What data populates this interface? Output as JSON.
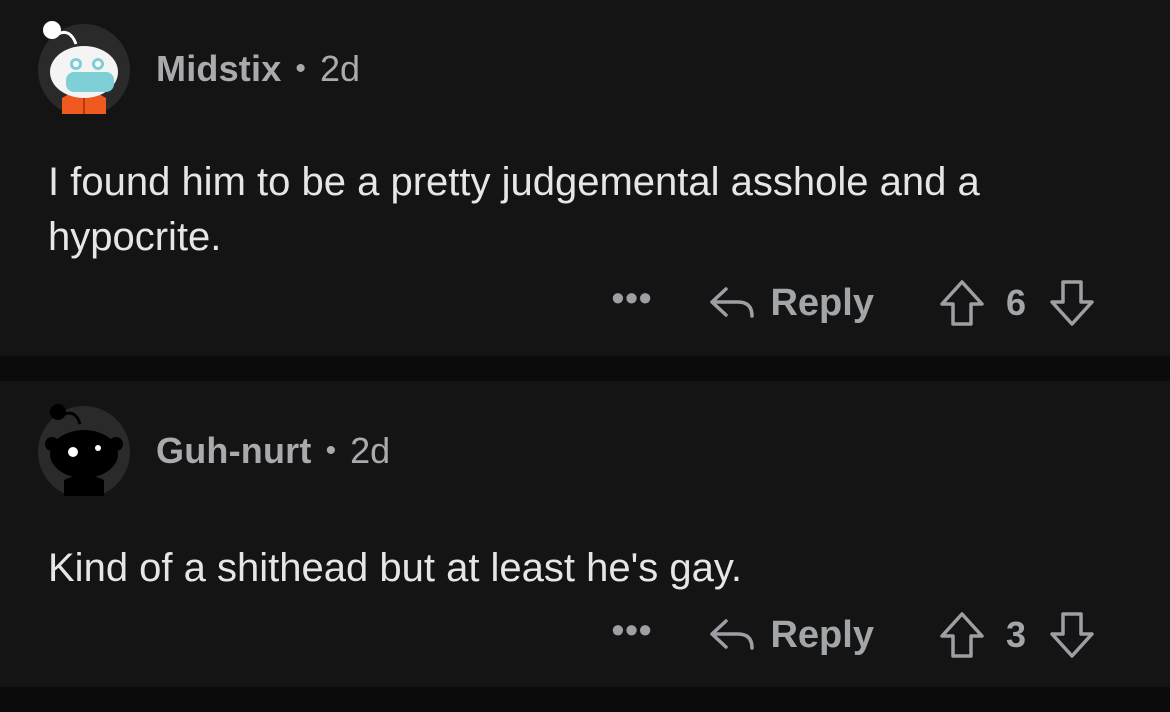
{
  "comments": [
    {
      "username": "Midstix",
      "separator": "•",
      "age": "2d",
      "body": "I found him to be a pretty judgemental asshole and a hypocrite.",
      "more_label": "•••",
      "reply_label": "Reply",
      "score": "6",
      "avatar": "snoo-avatar-mask-orange-jacket"
    },
    {
      "username": "Guh-nurt",
      "separator": "•",
      "age": "2d",
      "body": "Kind of a shithead but at least he's gay.",
      "more_label": "•••",
      "reply_label": "Reply",
      "score": "3",
      "avatar": "snoo-avatar-black"
    }
  ],
  "colors": {
    "background": "#0b0b0b",
    "card": "#141414",
    "text": "#e4e6e8",
    "meta": "#a8aaad",
    "icon": "#9c9fa3",
    "jacket": "#f05a1e",
    "mask": "#7fd0d6"
  },
  "icons": [
    "reply-arrow-icon",
    "upvote-arrow-icon",
    "downvote-arrow-icon",
    "more-options-icon"
  ]
}
